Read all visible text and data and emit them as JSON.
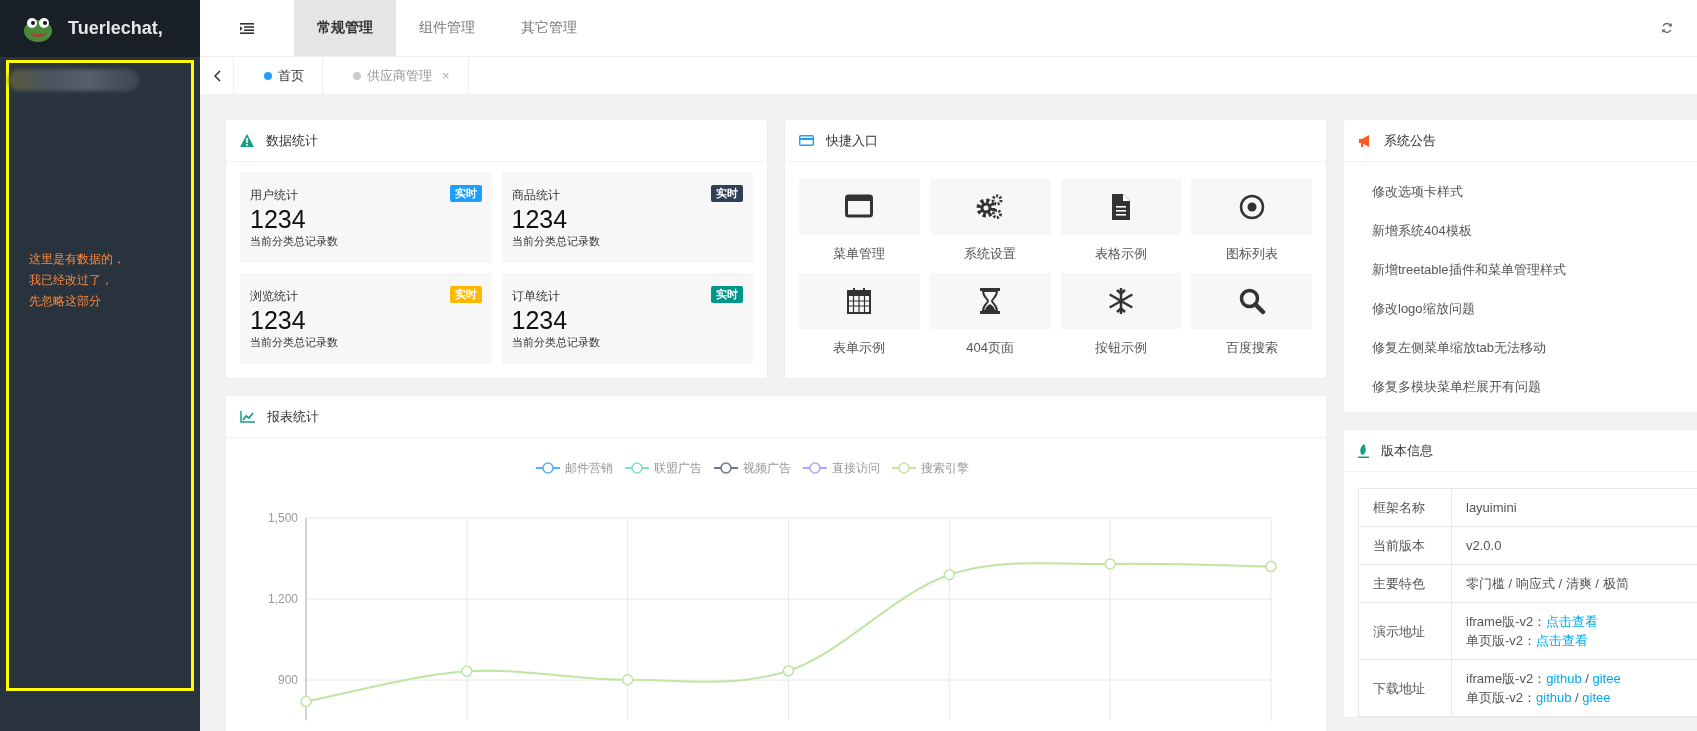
{
  "header": {
    "logo_text": "Tuerlechat,",
    "menu_tabs": [
      {
        "label": "常规管理",
        "selected": true
      },
      {
        "label": "组件管理",
        "selected": false
      },
      {
        "label": "其它管理",
        "selected": false
      }
    ]
  },
  "sidebar": {
    "note": [
      "这里是有数据的，",
      "我已经改过了，",
      "先忽略这部分"
    ]
  },
  "page_tabs": [
    {
      "label": "首页",
      "selected": true
    },
    {
      "label": "供应商管理",
      "selected": false,
      "close": "×"
    }
  ],
  "stats": {
    "title": "数据统计",
    "items": [
      {
        "label": "用户统计",
        "badge": "实时",
        "color": "#1e9fff",
        "value": "1234",
        "caption": "当前分类总记录数"
      },
      {
        "label": "商品统计",
        "badge": "实时",
        "color": "#2f4056",
        "value": "1234",
        "caption": "当前分类总记录数"
      },
      {
        "label": "浏览统计",
        "badge": "实时",
        "color": "#ffb800",
        "value": "1234",
        "caption": "当前分类总记录数"
      },
      {
        "label": "订单统计",
        "badge": "实时",
        "color": "#009688",
        "value": "1234",
        "caption": "当前分类总记录数"
      }
    ]
  },
  "shortcuts": {
    "title": "快捷入口",
    "items": [
      {
        "label": "菜单管理",
        "kind": "window"
      },
      {
        "label": "系统设置",
        "kind": "gears"
      },
      {
        "label": "表格示例",
        "kind": "document"
      },
      {
        "label": "图标列表",
        "kind": "target"
      },
      {
        "label": "表单示例",
        "kind": "calendar"
      },
      {
        "label": "404页面",
        "kind": "hourglass"
      },
      {
        "label": "按钮示例",
        "kind": "snowflake"
      },
      {
        "label": "百度搜索",
        "kind": "search"
      }
    ]
  },
  "report": {
    "title": "报表统计",
    "chart_data": {
      "type": "line",
      "grid": true,
      "ylim": [
        750,
        1500
      ],
      "yticks": [
        {
          "value": 900,
          "label": "900"
        },
        {
          "value": 1200,
          "label": "1,200"
        },
        {
          "value": 1500,
          "label": "1,500"
        }
      ],
      "series": [
        {
          "name": "邮件营销",
          "color": "#5ab1ef",
          "values": [
            null,
            null,
            null,
            null,
            null,
            null,
            null
          ]
        },
        {
          "name": "联盟广告",
          "color": "#7fe0c4",
          "values": [
            null,
            null,
            null,
            null,
            null,
            null,
            null
          ]
        },
        {
          "name": "视频广告",
          "color": "#6e7399",
          "values": [
            null,
            null,
            null,
            null,
            null,
            null,
            null
          ]
        },
        {
          "name": "直接访问",
          "color": "#a9a9ee",
          "values": [
            null,
            null,
            null,
            null,
            null,
            null,
            null
          ]
        },
        {
          "name": "搜索引擎",
          "color": "#bde6a2",
          "marker": "circle",
          "values": [
            820,
            932,
            901,
            934,
            1290,
            1330,
            1320
          ]
        }
      ]
    }
  },
  "notices": {
    "title": "系统公告",
    "items": [
      "修改选项卡样式",
      "新增系统404模板",
      "新增treetable插件和菜单管理样式",
      "修改logo缩放问题",
      "修复左侧菜单缩放tab无法移动",
      "修复多模块菜单栏展开有问题"
    ]
  },
  "version": {
    "title": "版本信息",
    "rows": [
      {
        "label": "框架名称",
        "lines": [
          [
            {
              "text": "layuimini",
              "link": false
            }
          ]
        ]
      },
      {
        "label": "当前版本",
        "lines": [
          [
            {
              "text": "v2.0.0",
              "link": false
            }
          ]
        ]
      },
      {
        "label": "主要特色",
        "lines": [
          [
            {
              "text": "零门槛 / 响应式 / 清爽 / 极简",
              "link": false
            }
          ]
        ]
      },
      {
        "label": "演示地址",
        "lines": [
          [
            {
              "text": "iframe版-v2：",
              "link": false
            },
            {
              "text": "点击查看",
              "link": true
            }
          ],
          [
            {
              "text": "单页版-v2：",
              "link": false
            },
            {
              "text": "点击查看",
              "link": true
            }
          ]
        ]
      },
      {
        "label": "下载地址",
        "lines": [
          [
            {
              "text": "iframe版-v2：",
              "link": false
            },
            {
              "text": "github",
              "link": true
            },
            {
              "text": " / ",
              "link": false
            },
            {
              "text": "gitee",
              "link": true
            }
          ],
          [
            {
              "text": "单页版-v2：",
              "link": false
            },
            {
              "text": "github",
              "link": true
            },
            {
              "text": " / ",
              "link": false
            },
            {
              "text": "gitee",
              "link": true
            }
          ]
        ]
      }
    ]
  }
}
